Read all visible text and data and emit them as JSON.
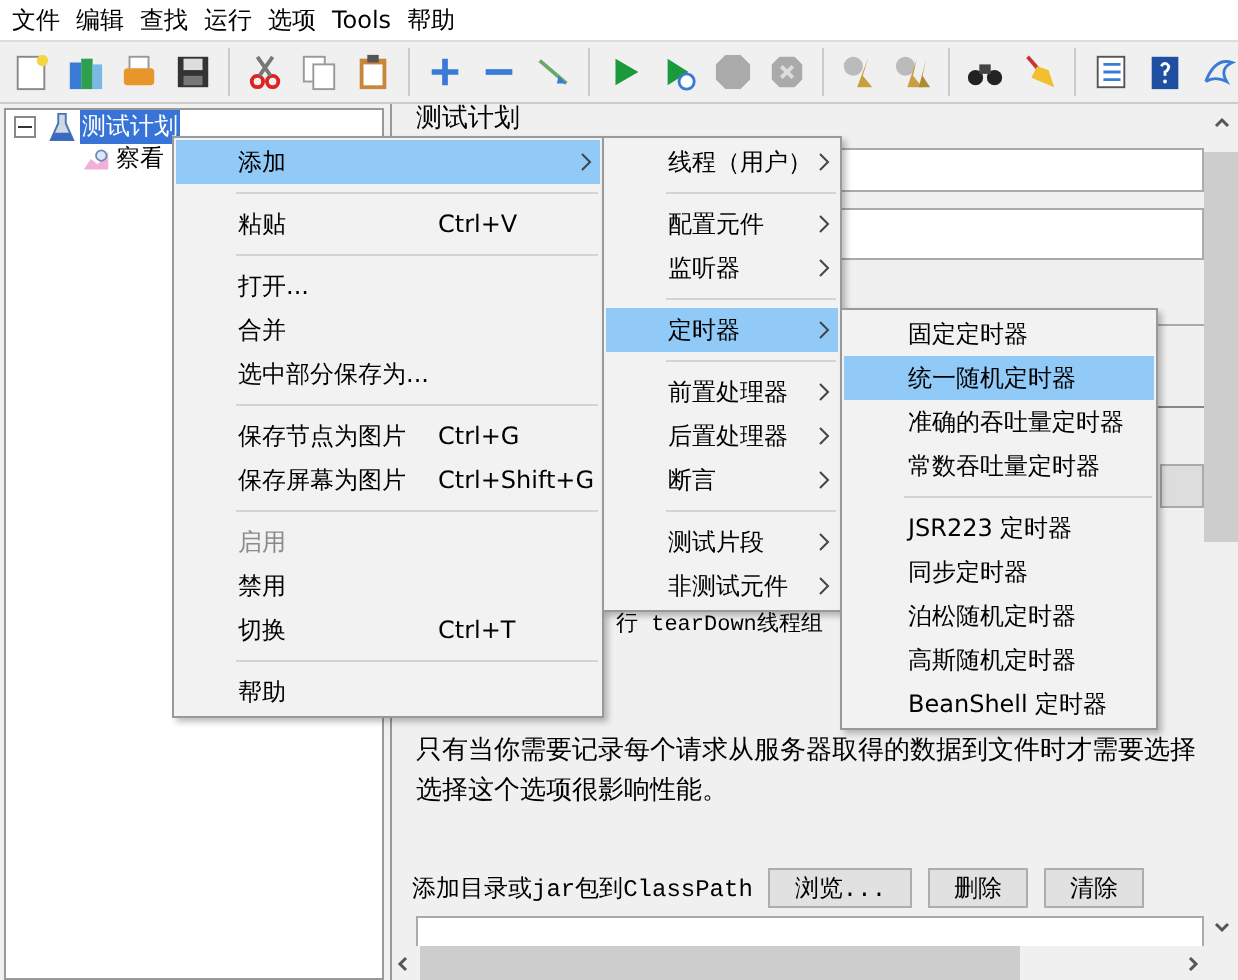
{
  "menu_bar": [
    {
      "label": "文件"
    },
    {
      "label": "编辑"
    },
    {
      "label": "查找"
    },
    {
      "label": "运行"
    },
    {
      "label": "选项"
    },
    {
      "label": "Tools"
    },
    {
      "label": "帮助"
    }
  ],
  "tree": [
    {
      "label": "测试计划",
      "selected": true,
      "expanded": true,
      "children": [
        {
          "label": "察看",
          "selected": false
        }
      ]
    }
  ],
  "panel": {
    "title": "测试计划",
    "teardown_label": "行 tearDown线程组",
    "note_lines": [
      "只有当你需要记录每个请求从服务器取得的数据到文件时才需要选择",
      "选择这个选项很影响性能。"
    ],
    "classpath_label": "添加目录或jar包到ClassPath",
    "buttons": [
      {
        "label": "浏览..."
      },
      {
        "label": "删除"
      },
      {
        "label": "清除"
      }
    ]
  },
  "context_menu": [
    {
      "kind": "item",
      "label": "添加",
      "submenu": true,
      "selected": true,
      "disabled": false
    },
    {
      "kind": "separator"
    },
    {
      "kind": "item",
      "label": "粘贴",
      "shortcut": "Ctrl+V",
      "submenu": false,
      "selected": false,
      "disabled": false
    },
    {
      "kind": "separator"
    },
    {
      "kind": "item",
      "label": "打开...",
      "submenu": false,
      "selected": false,
      "disabled": false
    },
    {
      "kind": "item",
      "label": "合并",
      "submenu": false,
      "selected": false,
      "disabled": false
    },
    {
      "kind": "item",
      "label": "选中部分保存为...",
      "submenu": false,
      "selected": false,
      "disabled": false
    },
    {
      "kind": "separator"
    },
    {
      "kind": "item",
      "label": "保存节点为图片",
      "shortcut": "Ctrl+G",
      "submenu": false,
      "selected": false,
      "disabled": false
    },
    {
      "kind": "item",
      "label": "保存屏幕为图片",
      "shortcut": "Ctrl+Shift+G",
      "submenu": false,
      "selected": false,
      "disabled": false
    },
    {
      "kind": "separator"
    },
    {
      "kind": "item",
      "label": "启用",
      "submenu": false,
      "selected": false,
      "disabled": true
    },
    {
      "kind": "item",
      "label": "禁用",
      "submenu": false,
      "selected": false,
      "disabled": false
    },
    {
      "kind": "item",
      "label": "切换",
      "shortcut": "Ctrl+T",
      "submenu": false,
      "selected": false,
      "disabled": false
    },
    {
      "kind": "separator"
    },
    {
      "kind": "item",
      "label": "帮助",
      "submenu": false,
      "selected": false,
      "disabled": false
    }
  ],
  "add_submenu": [
    {
      "kind": "item",
      "label": "线程（用户）",
      "submenu": true,
      "selected": false
    },
    {
      "kind": "separator"
    },
    {
      "kind": "item",
      "label": "配置元件",
      "submenu": true,
      "selected": false
    },
    {
      "kind": "item",
      "label": "监听器",
      "submenu": true,
      "selected": false
    },
    {
      "kind": "separator"
    },
    {
      "kind": "item",
      "label": "定时器",
      "submenu": true,
      "selected": true
    },
    {
      "kind": "separator"
    },
    {
      "kind": "item",
      "label": "前置处理器",
      "submenu": true,
      "selected": false
    },
    {
      "kind": "item",
      "label": "后置处理器",
      "submenu": true,
      "selected": false
    },
    {
      "kind": "item",
      "label": "断言",
      "submenu": true,
      "selected": false
    },
    {
      "kind": "separator"
    },
    {
      "kind": "item",
      "label": "测试片段",
      "submenu": true,
      "selected": false
    },
    {
      "kind": "item",
      "label": "非测试元件",
      "submenu": true,
      "selected": false
    }
  ],
  "timer_submenu": [
    {
      "kind": "item",
      "label": "固定定时器",
      "selected": false
    },
    {
      "kind": "item",
      "label": "统一随机定时器",
      "selected": true
    },
    {
      "kind": "item",
      "label": "准确的吞吐量定时器",
      "selected": false
    },
    {
      "kind": "item",
      "label": "常数吞吐量定时器",
      "selected": false
    },
    {
      "kind": "separator"
    },
    {
      "kind": "item",
      "label": "JSR223 定时器",
      "selected": false
    },
    {
      "kind": "item",
      "label": "同步定时器",
      "selected": false
    },
    {
      "kind": "item",
      "label": "泊松随机定时器",
      "selected": false
    },
    {
      "kind": "item",
      "label": "高斯随机定时器",
      "selected": false
    },
    {
      "kind": "item",
      "label": "BeanShell 定时器",
      "selected": false
    }
  ]
}
